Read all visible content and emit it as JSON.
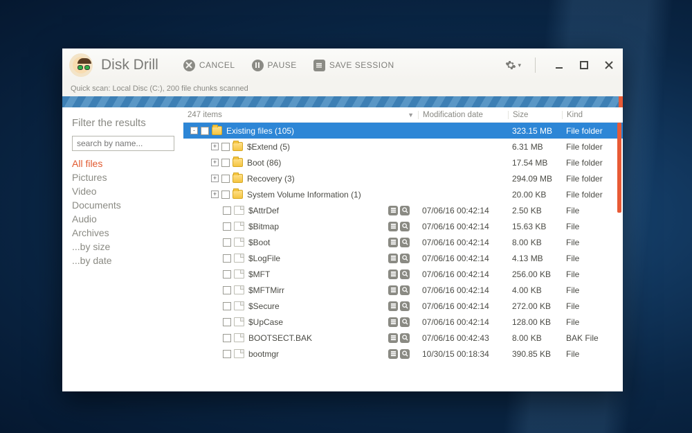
{
  "app": {
    "title": "Disk Drill"
  },
  "toolbar": {
    "cancel": "CANCEL",
    "pause": "PAUSE",
    "save_session": "SAVE SESSION"
  },
  "status": "Quick scan: Local Disc (C:), 200 file chunks scanned",
  "sidebar": {
    "title": "Filter the results",
    "search_placeholder": "search by name...",
    "filters": [
      "All files",
      "Pictures",
      "Video",
      "Documents",
      "Audio",
      "Archives",
      "...by size",
      "...by date"
    ],
    "active_index": 0
  },
  "columns": {
    "items_count": "247 items",
    "date": "Modification date",
    "size": "Size",
    "kind": "Kind"
  },
  "rows": [
    {
      "indent": 0,
      "expander": "-",
      "type": "folder",
      "name": "Existing files (105)",
      "date": "",
      "size": "323.15 MB",
      "kind": "File folder",
      "selected": true,
      "actions": false
    },
    {
      "indent": 1,
      "expander": "+",
      "type": "folder",
      "name": "$Extend (5)",
      "date": "",
      "size": "6.31 MB",
      "kind": "File folder",
      "actions": false
    },
    {
      "indent": 1,
      "expander": "+",
      "type": "folder",
      "name": "Boot (86)",
      "date": "",
      "size": "17.54 MB",
      "kind": "File folder",
      "actions": false
    },
    {
      "indent": 1,
      "expander": "+",
      "type": "folder",
      "name": "Recovery (3)",
      "date": "",
      "size": "294.09 MB",
      "kind": "File folder",
      "actions": false
    },
    {
      "indent": 1,
      "expander": "+",
      "type": "folder",
      "name": "System Volume Information (1)",
      "date": "",
      "size": "20.00 KB",
      "kind": "File folder",
      "actions": false
    },
    {
      "indent": 1,
      "expander": "",
      "type": "file",
      "name": "$AttrDef",
      "date": "07/06/16 00:42:14",
      "size": "2.50 KB",
      "kind": "File",
      "actions": true
    },
    {
      "indent": 1,
      "expander": "",
      "type": "file",
      "name": "$Bitmap",
      "date": "07/06/16 00:42:14",
      "size": "15.63 KB",
      "kind": "File",
      "actions": true
    },
    {
      "indent": 1,
      "expander": "",
      "type": "file",
      "name": "$Boot",
      "date": "07/06/16 00:42:14",
      "size": "8.00 KB",
      "kind": "File",
      "actions": true
    },
    {
      "indent": 1,
      "expander": "",
      "type": "file",
      "name": "$LogFile",
      "date": "07/06/16 00:42:14",
      "size": "4.13 MB",
      "kind": "File",
      "actions": true
    },
    {
      "indent": 1,
      "expander": "",
      "type": "file",
      "name": "$MFT",
      "date": "07/06/16 00:42:14",
      "size": "256.00 KB",
      "kind": "File",
      "actions": true
    },
    {
      "indent": 1,
      "expander": "",
      "type": "file",
      "name": "$MFTMirr",
      "date": "07/06/16 00:42:14",
      "size": "4.00 KB",
      "kind": "File",
      "actions": true
    },
    {
      "indent": 1,
      "expander": "",
      "type": "file",
      "name": "$Secure",
      "date": "07/06/16 00:42:14",
      "size": "272.00 KB",
      "kind": "File",
      "actions": true
    },
    {
      "indent": 1,
      "expander": "",
      "type": "file",
      "name": "$UpCase",
      "date": "07/06/16 00:42:14",
      "size": "128.00 KB",
      "kind": "File",
      "actions": true
    },
    {
      "indent": 1,
      "expander": "",
      "type": "file",
      "name": "BOOTSECT.BAK",
      "date": "07/06/16 00:42:43",
      "size": "8.00 KB",
      "kind": "BAK File",
      "actions": true
    },
    {
      "indent": 1,
      "expander": "",
      "type": "file",
      "name": "bootmgr",
      "date": "10/30/15 00:18:34",
      "size": "390.85 KB",
      "kind": "File",
      "actions": true
    }
  ]
}
